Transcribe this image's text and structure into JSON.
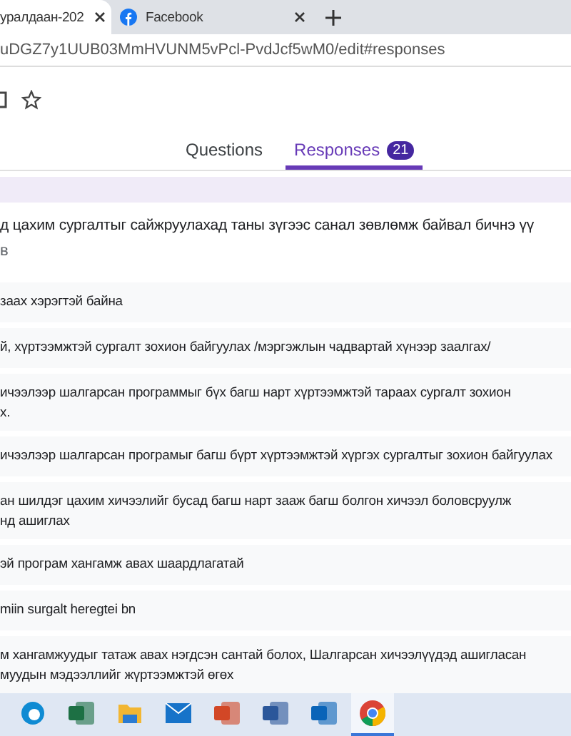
{
  "browser_tabs": [
    {
      "title": "уралдаан-202",
      "selected": true
    },
    {
      "title": "Facebook",
      "selected": false
    }
  ],
  "address": "uDGZ7y1UUB03MmHVUNM5vPcl-PvdJcf5wM0/edit#responses",
  "form_tabs": [
    {
      "label": "Questions",
      "selected": false
    },
    {
      "label": "Responses",
      "selected": true,
      "count": "21"
    }
  ],
  "question": {
    "title": "д цахим сургалтыг сайжруулахад таны зүгээс санал зөвлөмж байвал бичнэ үү",
    "subtitle": "в"
  },
  "responses": [
    "заах хэрэгтэй байна",
    "й, хүртээмжтэй сургалт зохион байгуулах /мэргэжлын чадвартай хүнээр заалгах/",
    "ичээлээр шалгарсан программыг бүх багш нарт хүртээмжтэй тараах сургалт зохион\nх.",
    "ичээлээр шалгарсан програмыг багш бүрт хүртээмжтэй хүргэх сургалтыг зохион байгуулах",
    "ан шилдэг цахим хичээлийг бусад багш нарт зааж багш болгон хичээл боловсруулж\nнд ашиглах",
    "эй програм хангамж авах шаардлагатай",
    "miin surgalt heregtei bn",
    "м хангамжуудыг татаж авах нэгдсэн сантай болох, Шалгарсан хичээлүүдэд ашигласан\nмуудын мэдээллийг жүртээмжтэй өгөх"
  ],
  "taskbar": [
    {
      "kind": "edge",
      "selected": false
    },
    {
      "kind": "excel",
      "selected": false
    },
    {
      "kind": "folder",
      "selected": false
    },
    {
      "kind": "mail",
      "selected": false
    },
    {
      "kind": "powerpoint",
      "selected": false
    },
    {
      "kind": "word",
      "selected": false
    },
    {
      "kind": "outlook",
      "selected": false
    },
    {
      "kind": "chrome",
      "selected": true
    }
  ]
}
